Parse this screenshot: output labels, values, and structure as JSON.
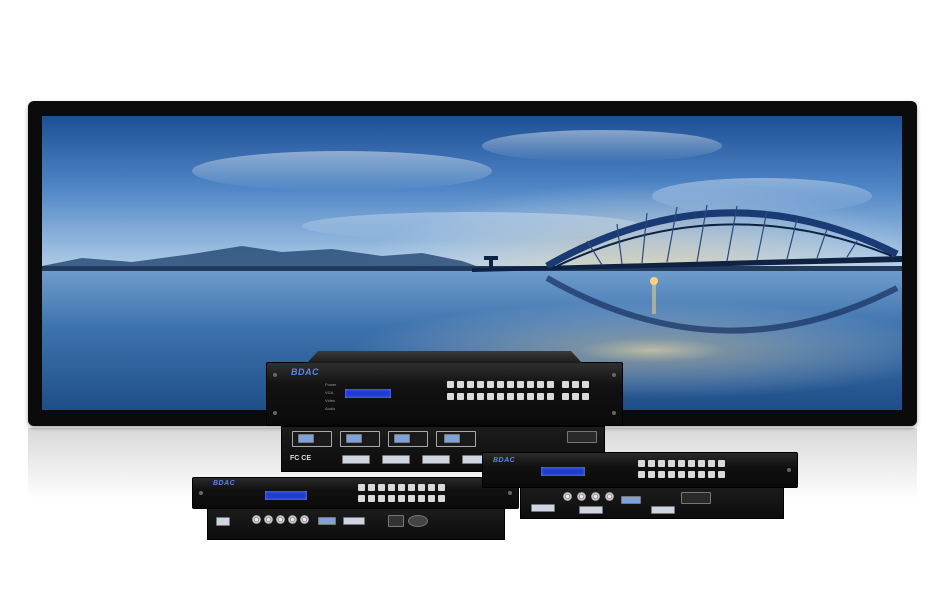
{
  "image": {
    "description_alt": "",
    "scene": "panoramic-monitor-with-video-processors"
  },
  "screen": {
    "sky_colors": [
      "#1d4f94",
      "#4f86c6",
      "#a9c8e4"
    ],
    "water_colors": [
      "#1b4f8a",
      "#6a99c9"
    ],
    "bridge_color": "#0e2243"
  },
  "devices": {
    "brand_label": "BDAC",
    "lcd_color": "#1f3bd1",
    "main_leds": [
      "Power",
      "VGA",
      "Video",
      "Audio"
    ],
    "rear_marks": "FC CE"
  }
}
